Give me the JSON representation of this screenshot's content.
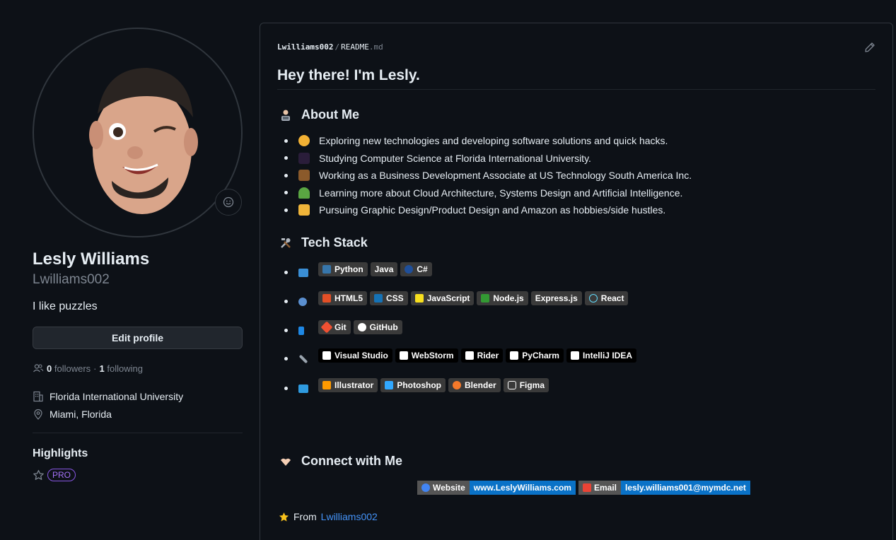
{
  "profile": {
    "full_name": "Lesly Williams",
    "username": "Lwilliams002",
    "bio": "I like puzzles",
    "edit_label": "Edit profile",
    "followers_count": "0",
    "followers_label": "followers",
    "dot": "·",
    "following_count": "1",
    "following_label": "following",
    "organization": "Florida International University",
    "location": "Miami, Florida",
    "highlights_title": "Highlights",
    "pro_badge": "PRO"
  },
  "readme": {
    "crumb_user": "Lwilliams002",
    "crumb_sep": "/",
    "crumb_file": "README",
    "crumb_ext": ".md",
    "title": "Hey there! I'm Lesly.",
    "about_heading": "About Me",
    "about_items": [
      "Exploring new technologies and developing software solutions and quick hacks.",
      "Studying Computer Science at Florida International University.",
      "Working as a Business Development Associate at US Technology South America Inc.",
      "Learning more about Cloud Architecture, Systems Design and Artificial Intelligence.",
      "Pursuing Graphic Design/Product Design and Amazon as hobbies/side hustles."
    ],
    "tech_heading": "Tech Stack",
    "tech_rows": [
      [
        "Python",
        "Java",
        "C#"
      ],
      [
        "HTML5",
        "CSS",
        "JavaScript",
        "Node.js",
        "Express.js",
        "React"
      ],
      [
        "Git",
        "GitHub"
      ],
      [
        "Visual Studio",
        "WebStorm",
        "Rider",
        "PyCharm",
        "IntelliJ IDEA"
      ],
      [
        "Illustrator",
        "Photoshop",
        "Blender",
        "Figma"
      ]
    ],
    "connect_heading": "Connect with Me",
    "website_label": "Website",
    "website_value": "www.LeslyWilliams.com",
    "email_label": "Email",
    "email_value": "lesly.williams001@mymdc.net",
    "from_label": "From",
    "from_link": "Lwilliams002"
  },
  "colors": {
    "background": "#0d1117",
    "border": "#30363d",
    "link": "#4493f8",
    "pro": "#a371f7",
    "connect_value": "#0a72c7"
  }
}
